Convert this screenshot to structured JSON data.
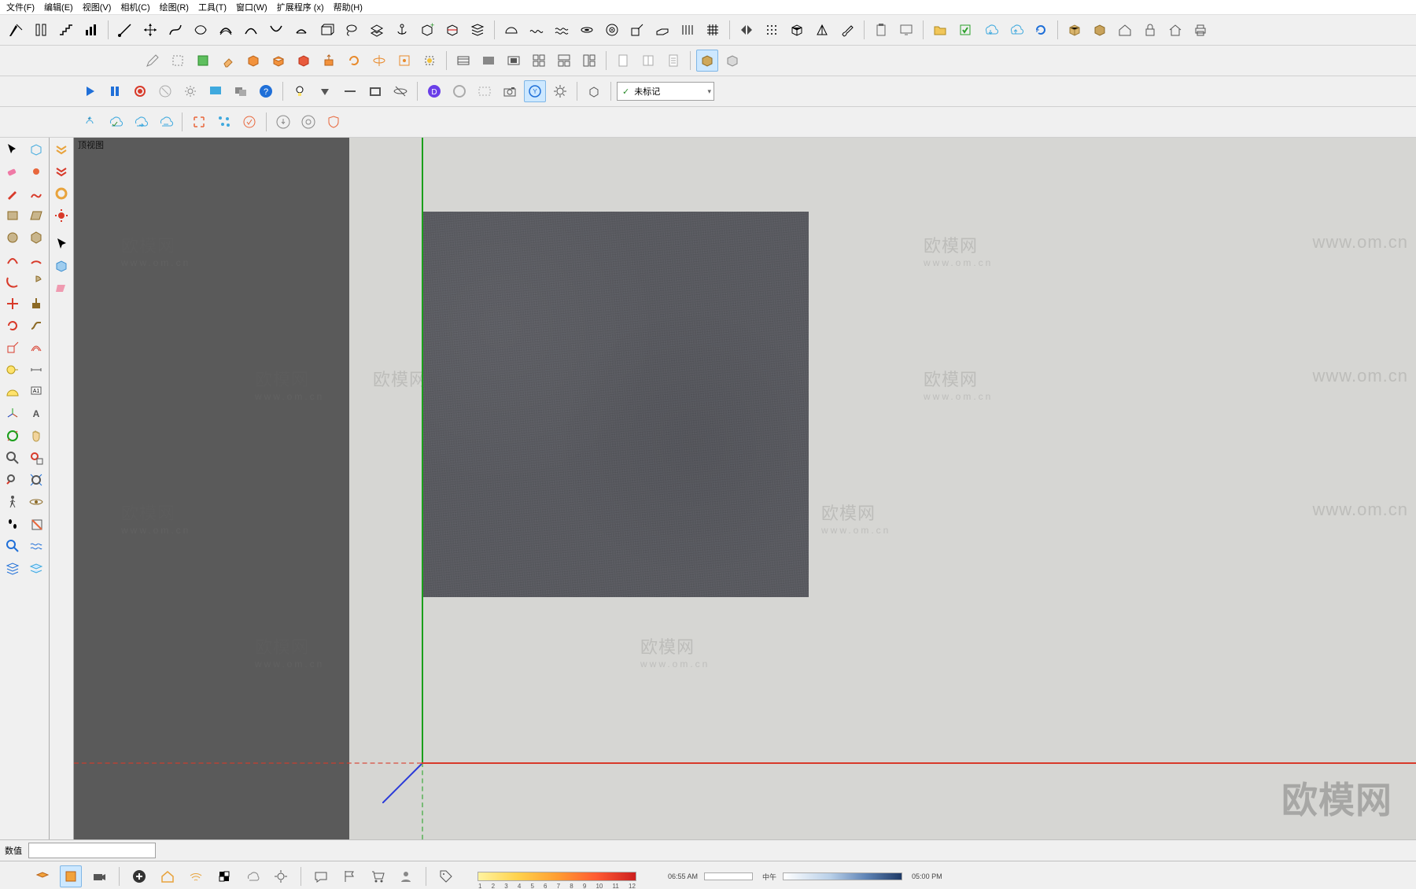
{
  "menu": {
    "file": "文件(F)",
    "edit": "编辑(E)",
    "view": "视图(V)",
    "camera": "相机(C)",
    "draw": "绘图(R)",
    "tools": "工具(T)",
    "window": "窗口(W)",
    "ext": "扩展程序 (x)",
    "help": "帮助(H)"
  },
  "viewport": {
    "label": "顶视图"
  },
  "tag_dropdown": {
    "prefix": "✓",
    "value": "未标记"
  },
  "status": {
    "label": "数值",
    "value": ""
  },
  "tray": {
    "scale_ticks": [
      "1",
      "2",
      "3",
      "4",
      "5",
      "6",
      "7",
      "8",
      "9",
      "10",
      "11",
      "12"
    ],
    "time_start": "06:55 AM",
    "time_mid": "中午",
    "time_end": "05:00 PM"
  },
  "watermarks": {
    "brand": "欧模网",
    "url": "www.om.cn"
  }
}
